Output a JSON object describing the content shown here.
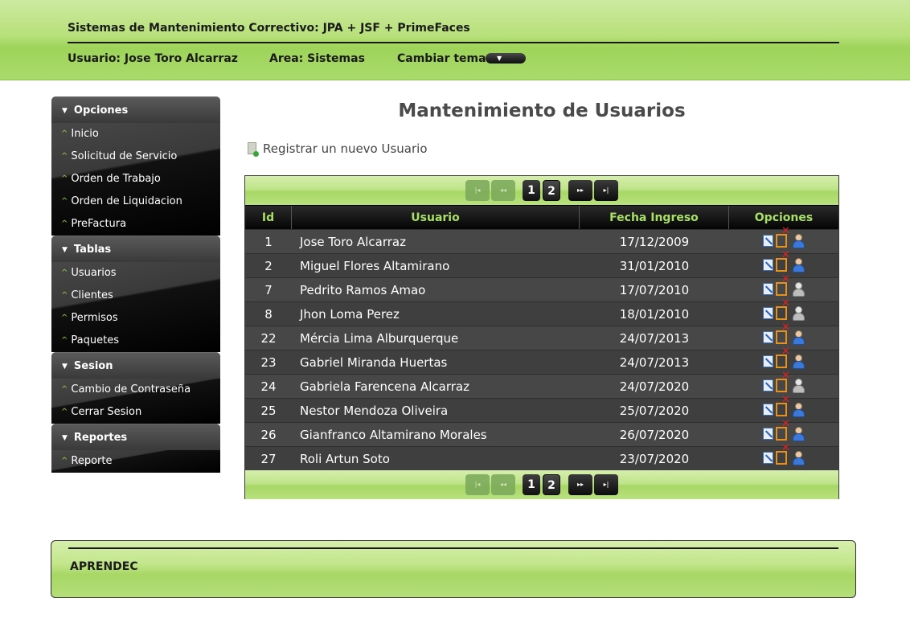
{
  "header": {
    "title": "Sistemas de Mantenimiento Correctivo: JPA + JSF + PrimeFaces",
    "user": "Usuario: Jose Toro Alcarraz",
    "area": "Area: Sistemas",
    "theme_label": "Cambiar tema:",
    "theme_arrow": "▼"
  },
  "sidebar": {
    "panels": [
      {
        "title": "Opciones",
        "items": [
          "Inicio",
          "Solicitud de Servicio",
          "Orden de Trabajo",
          "Orden de Liquidacion",
          "PreFactura"
        ]
      },
      {
        "title": "Tablas",
        "items": [
          "Usuarios",
          "Clientes",
          "Permisos",
          "Paquetes"
        ]
      },
      {
        "title": "Sesion",
        "items": [
          "Cambio de Contraseña",
          "Cerrar Sesion"
        ]
      },
      {
        "title": "Reportes",
        "items": [
          "Reporte"
        ]
      }
    ]
  },
  "main": {
    "title": "Mantenimiento de Usuarios",
    "register_link": "Registrar un nuevo Usuario",
    "pager": {
      "first": "|◂",
      "prev": "◂◂",
      "pages": [
        "1",
        "2"
      ],
      "next": "▸▸",
      "last": "▸|"
    },
    "columns": [
      "Id",
      "Usuario",
      "Fecha Ingreso",
      "Opciones"
    ],
    "rows": [
      {
        "id": "1",
        "user": "Jose Toro Alcarraz",
        "date": "17/12/2009",
        "status_icon": "blue"
      },
      {
        "id": "2",
        "user": "Miguel Flores Altamirano",
        "date": "31/01/2010",
        "status_icon": "blue"
      },
      {
        "id": "7",
        "user": "Pedrito Ramos Amao",
        "date": "17/07/2010",
        "status_icon": "gray"
      },
      {
        "id": "8",
        "user": "Jhon Loma Perez",
        "date": "18/01/2010",
        "status_icon": "gray"
      },
      {
        "id": "22",
        "user": "Mércia Lima Alburquerque",
        "date": "24/07/2013",
        "status_icon": "blue"
      },
      {
        "id": "23",
        "user": "Gabriel Miranda Huertas",
        "date": "24/07/2013",
        "status_icon": "blue"
      },
      {
        "id": "24",
        "user": "Gabriela Farencena Alcarraz",
        "date": "24/07/2020",
        "status_icon": "gray"
      },
      {
        "id": "25",
        "user": "Nestor Mendoza Oliveira",
        "date": "25/07/2020",
        "status_icon": "blue"
      },
      {
        "id": "26",
        "user": "Gianfranco Altamirano Morales",
        "date": "26/07/2020",
        "status_icon": "blue"
      },
      {
        "id": "27",
        "user": "Roli Artun Soto",
        "date": "23/07/2020",
        "status_icon": "blue"
      }
    ]
  },
  "footer": {
    "brand": "APRENDEC"
  }
}
